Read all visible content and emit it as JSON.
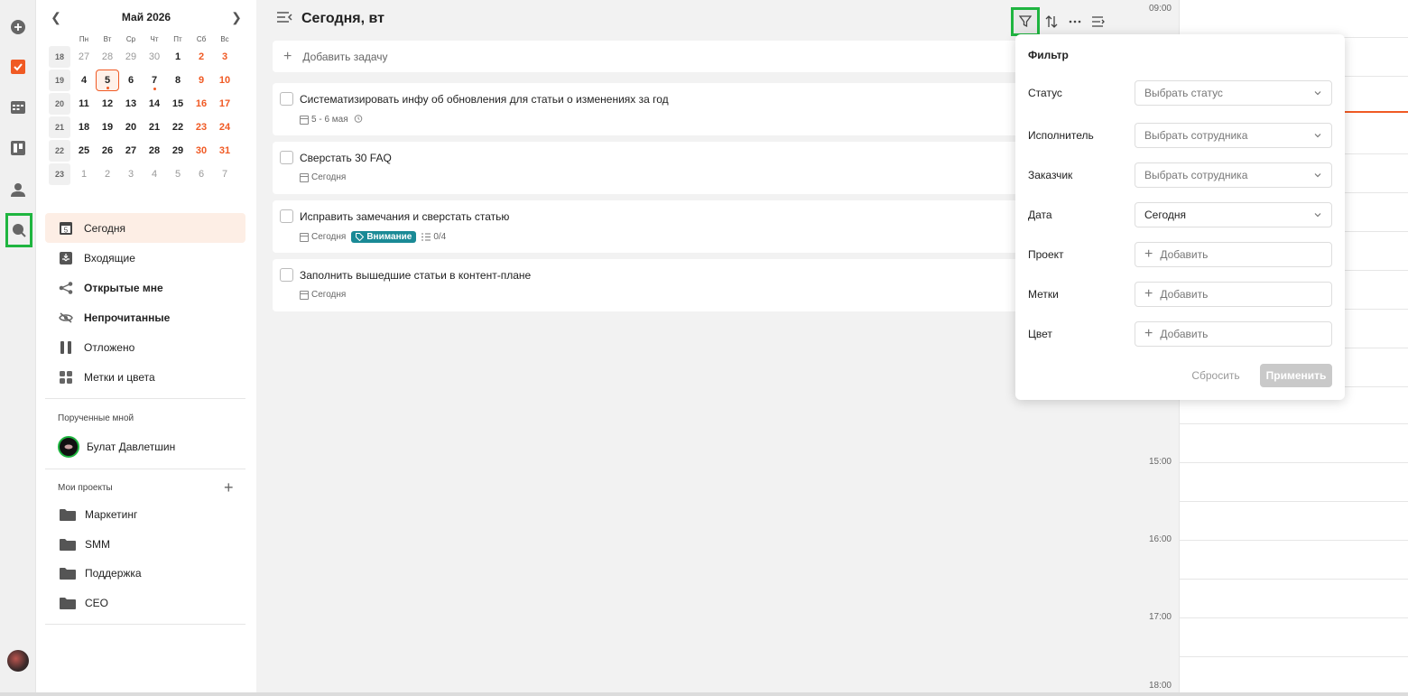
{
  "calendar": {
    "month": "Май 2026",
    "weekdays": [
      "Пн",
      "Вт",
      "Ср",
      "Чт",
      "Пт",
      "Сб",
      "Вс"
    ],
    "weeks": [
      {
        "num": "18",
        "days": [
          "27",
          "28",
          "29",
          "30",
          "1",
          "2",
          "3"
        ]
      },
      {
        "num": "19",
        "days": [
          "4",
          "5",
          "6",
          "7",
          "8",
          "9",
          "10"
        ]
      },
      {
        "num": "20",
        "days": [
          "11",
          "12",
          "13",
          "14",
          "15",
          "16",
          "17"
        ]
      },
      {
        "num": "21",
        "days": [
          "18",
          "19",
          "20",
          "21",
          "22",
          "23",
          "24"
        ]
      },
      {
        "num": "22",
        "days": [
          "25",
          "26",
          "27",
          "28",
          "29",
          "30",
          "31"
        ]
      },
      {
        "num": "23",
        "days": [
          "1",
          "2",
          "3",
          "4",
          "5",
          "6",
          "7"
        ]
      }
    ]
  },
  "sidebar": {
    "nav": [
      {
        "label": "Сегодня",
        "icon": "calendar-today-icon"
      },
      {
        "label": "Входящие",
        "icon": "inbox-icon"
      },
      {
        "label": "Открытые мне",
        "icon": "share-icon"
      },
      {
        "label": "Непрочитанные",
        "icon": "eye-off-icon"
      },
      {
        "label": "Отложено",
        "icon": "pause-icon"
      },
      {
        "label": "Метки и цвета",
        "icon": "grid-icon"
      }
    ],
    "assigned_title": "Порученные мной",
    "assigned_person": "Булат Давлетшин",
    "projects_title": "Мои проекты",
    "projects": [
      "Маркетинг",
      "SMM",
      "Поддержка",
      "CEO"
    ]
  },
  "main": {
    "title": "Сегодня, вт",
    "add_task": "Добавить задачу",
    "tasks": [
      {
        "title": "Систематизировать инфу об обновления для статьи о изменениях за год",
        "date": "5 - 6 мая"
      },
      {
        "title": "Сверстать 30 FAQ",
        "date": "Сегодня"
      },
      {
        "title": "Исправить замечания и сверстать статью",
        "date": "Сегодня",
        "tag": "Внимание",
        "checklist": "0/4"
      },
      {
        "title": "Заполнить вышедшие статьи в контент-плане",
        "date": "Сегодня"
      }
    ]
  },
  "timeline": {
    "labels": [
      "09:00",
      "15:00",
      "16:00",
      "17:00",
      "18:00"
    ],
    "now_color": "#f05a24"
  },
  "filter": {
    "title": "Фильтр",
    "rows": [
      {
        "label": "Статус",
        "value": "Выбрать статус",
        "kind": "select"
      },
      {
        "label": "Исполнитель",
        "value": "Выбрать сотрудника",
        "kind": "select"
      },
      {
        "label": "Заказчик",
        "value": "Выбрать сотрудника",
        "kind": "select"
      },
      {
        "label": "Дата",
        "value": "Сегодня",
        "kind": "select"
      },
      {
        "label": "Проект",
        "value": "Добавить",
        "kind": "add"
      },
      {
        "label": "Метки",
        "value": "Добавить",
        "kind": "add"
      },
      {
        "label": "Цвет",
        "value": "Добавить",
        "kind": "add"
      }
    ],
    "reset": "Сбросить",
    "apply": "Применить"
  },
  "colors": {
    "accent": "#f05a24",
    "tag": "#1a8a96",
    "highlight": "#1fb540"
  }
}
